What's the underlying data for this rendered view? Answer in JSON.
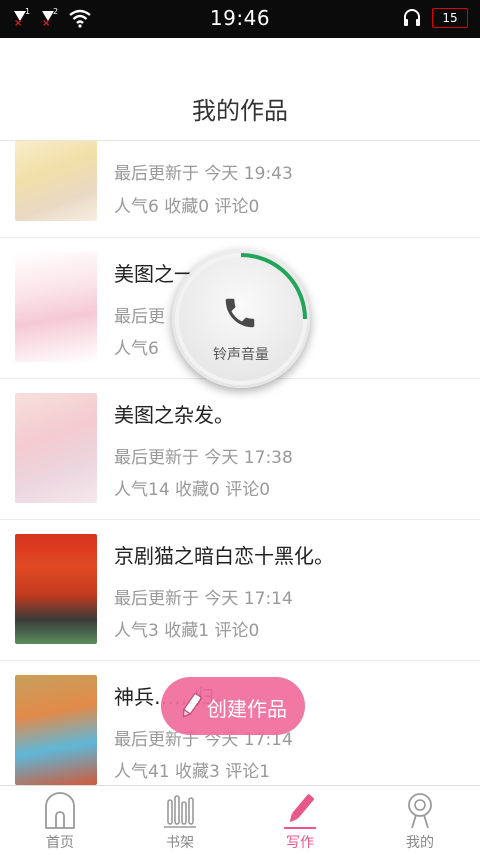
{
  "status_bar": {
    "sim1": "1",
    "sim2": "2",
    "time": "19:46",
    "battery": "15"
  },
  "header": {
    "title": "我的作品"
  },
  "works": [
    {
      "title": "",
      "updated": "最后更新于 今天 19:43",
      "stats": "人气6 收藏0 评论0"
    },
    {
      "title": "美图之一……同。",
      "updated": "最后更",
      "stats": "人气6"
    },
    {
      "title": "美图之杂发。",
      "updated": "最后更新于 今天 17:38",
      "stats": "人气14 收藏0 评论0"
    },
    {
      "title": "京剧猫之暗白恋十黑化。",
      "updated": "最后更新于 今天 17:14",
      "stats": "人气3 收藏1 评论0"
    },
    {
      "title": "神兵……归。",
      "updated": "最后更新于 今天 17:14",
      "stats": "人气41 收藏3 评论1"
    }
  ],
  "create_button": {
    "label": "创建作品",
    "color": "#f06e9d"
  },
  "volume_overlay": {
    "label": "铃声音量",
    "icon": "phone-icon",
    "accent": "#22a55a"
  },
  "tabs": [
    {
      "label": "首页",
      "icon": "home-icon"
    },
    {
      "label": "书架",
      "icon": "bookshelf-icon"
    },
    {
      "label": "写作",
      "icon": "pen-icon",
      "active": true
    },
    {
      "label": "我的",
      "icon": "user-icon"
    }
  ],
  "colors": {
    "accent": "#e8578a",
    "status_bar": "#0b0b0b"
  }
}
